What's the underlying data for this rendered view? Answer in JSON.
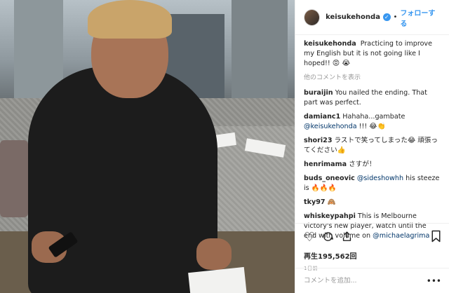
{
  "post": {
    "username": "keisukehonda",
    "verified_mark": "✓",
    "separator": "•",
    "follow_label": "フォローする"
  },
  "caption": {
    "user": "keisukehonda",
    "text": "Practicing to improve my English but it is not going like I hoped!!",
    "emoji": "😡 😭"
  },
  "load_more": "他のコメントを表示",
  "comments": [
    {
      "user": "buraijin",
      "text": "You nailed the ending. That part was perfect.",
      "mention": "",
      "suffix": ""
    },
    {
      "user": "damianc1",
      "text": "Hahaha...gambate",
      "mention": "@keisukehonda",
      "suffix": "!!! 😂👏"
    },
    {
      "user": "shori23",
      "text": "ラストで笑ってしまった😂 頑張ってください👍",
      "mention": "",
      "suffix": ""
    },
    {
      "user": "henrimama",
      "text": "さすが！",
      "mention": "",
      "suffix": ""
    },
    {
      "user": "buds_oneovic",
      "text": "",
      "mention": "@sideshowhh",
      "suffix": "his steeze is 🔥🔥🔥"
    },
    {
      "user": "tky97",
      "text": "🙈",
      "mention": "",
      "suffix": ""
    },
    {
      "user": "whiskeypahpi",
      "text": "This is Melbourne victory's new player, watch until the end with volume on",
      "mention": "@michaelagrima",
      "suffix": ""
    }
  ],
  "actions": {
    "like_icon": "heart-icon",
    "comment_icon": "comment-icon",
    "share_icon": "share-icon",
    "save_icon": "bookmark-icon"
  },
  "views": "再生195,562回",
  "timestamp": "1日前",
  "add_comment": {
    "placeholder": "コメントを追加...",
    "more": "•••"
  },
  "colors": {
    "accent": "#3897f0",
    "mention": "#003569",
    "muted": "#999999"
  }
}
